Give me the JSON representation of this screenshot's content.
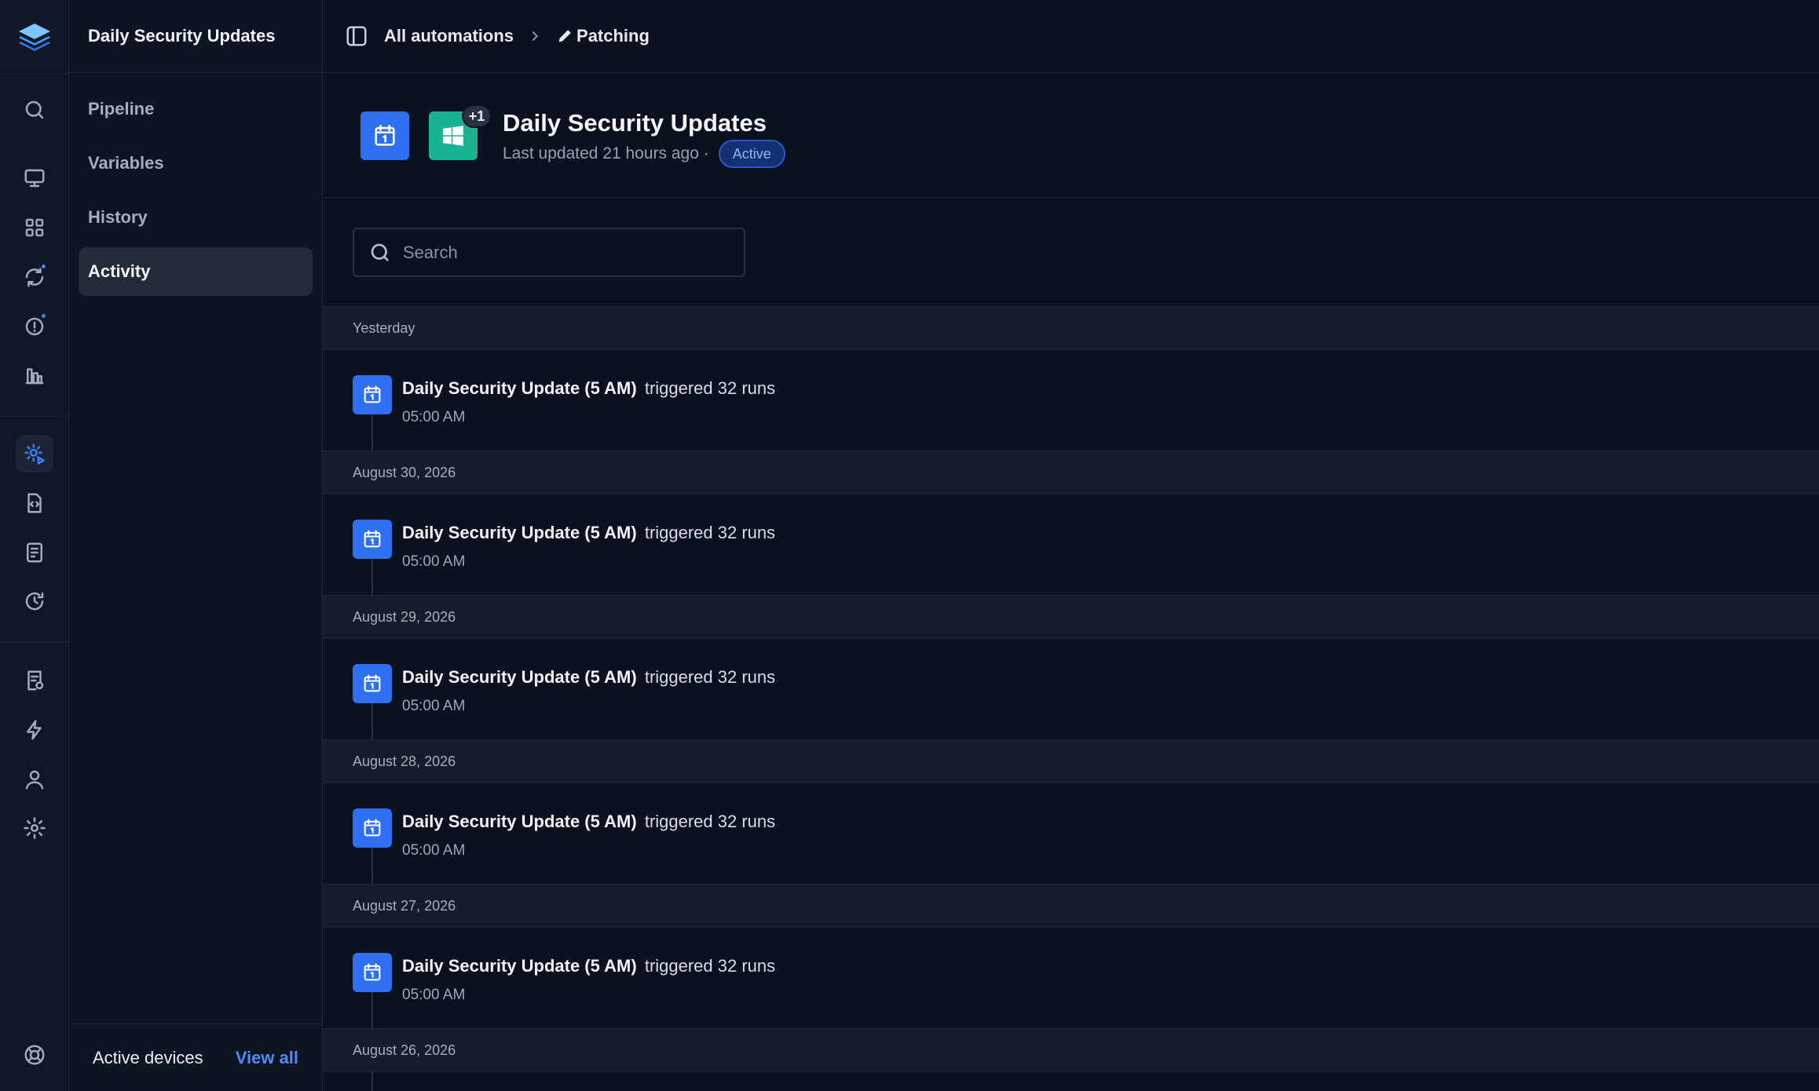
{
  "sidebar": {
    "title": "Daily Security Updates",
    "nav": [
      {
        "label": "Pipeline",
        "active": false
      },
      {
        "label": "Variables",
        "active": false
      },
      {
        "label": "History",
        "active": false
      },
      {
        "label": "Activity",
        "active": true
      }
    ],
    "footer": {
      "label": "Active devices",
      "link": "View all"
    }
  },
  "rail": {
    "icons": [
      "layers-logo-icon",
      "search-icon",
      "monitor-icon",
      "grid-icon",
      "refresh-icon",
      "alert-icon",
      "bar-chart-icon",
      "automation-icon",
      "code-file-icon",
      "document-icon",
      "history-icon",
      "policy-icon",
      "bolt-icon",
      "user-icon",
      "settings-icon",
      "help-icon"
    ],
    "active": "automation-icon",
    "accent": "#3b82f6"
  },
  "breadcrumb": {
    "root": "All automations",
    "current": "Patching"
  },
  "header": {
    "title": "Daily Security Updates",
    "subtitle": "Last updated 21 hours ago ·",
    "status": "Active",
    "extra_count": "+1"
  },
  "search": {
    "placeholder": "Search",
    "value": ""
  },
  "activity": {
    "groups": [
      {
        "date": "Yesterday",
        "events": [
          {
            "name": "Daily Security Update (5 AM)",
            "verb": "triggered 32 runs",
            "time": "05:00 AM"
          }
        ]
      },
      {
        "date": "August 30, 2026",
        "events": [
          {
            "name": "Daily Security Update (5 AM)",
            "verb": "triggered 32 runs",
            "time": "05:00 AM"
          }
        ]
      },
      {
        "date": "August 29, 2026",
        "events": [
          {
            "name": "Daily Security Update (5 AM)",
            "verb": "triggered 32 runs",
            "time": "05:00 AM"
          }
        ]
      },
      {
        "date": "August 28, 2026",
        "events": [
          {
            "name": "Daily Security Update (5 AM)",
            "verb": "triggered 32 runs",
            "time": "05:00 AM"
          }
        ]
      },
      {
        "date": "August 27, 2026",
        "events": [
          {
            "name": "Daily Security Update (5 AM)",
            "verb": "triggered 32 runs",
            "time": "05:00 AM"
          }
        ]
      },
      {
        "date": "August 26, 2026",
        "events": []
      }
    ]
  }
}
